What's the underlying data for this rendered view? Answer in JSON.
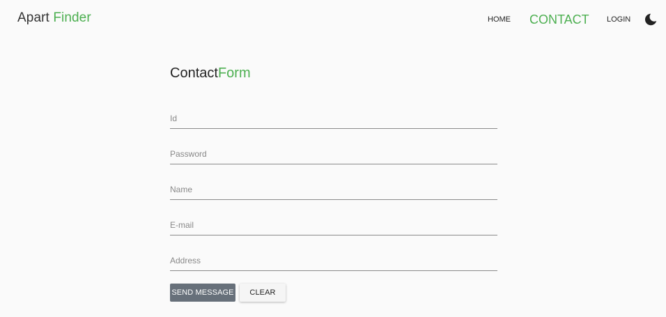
{
  "brand": {
    "prefix": "Apart",
    "accent": "Finder"
  },
  "nav": {
    "home": "HOME",
    "contact": "CONTACT",
    "login": "LOGIN",
    "theme_icon": "moon-icon"
  },
  "form": {
    "title_prefix": "Contact",
    "title_accent": "Form",
    "fields": [
      {
        "placeholder": "Id",
        "value": ""
      },
      {
        "placeholder": "Password",
        "value": ""
      },
      {
        "placeholder": "Name",
        "value": ""
      },
      {
        "placeholder": "E-mail",
        "value": ""
      },
      {
        "placeholder": "Address",
        "value": ""
      }
    ],
    "send_label": "SEND MESSAGE",
    "clear_label": "CLEAR"
  },
  "colors": {
    "accent": "#4caf50",
    "background": "#fafafa",
    "send_button": "#67707a"
  }
}
